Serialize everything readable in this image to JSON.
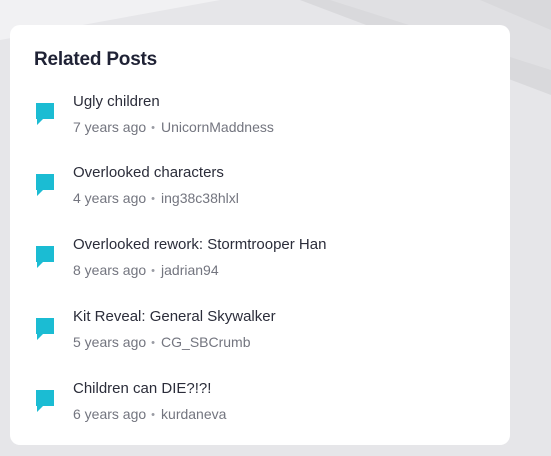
{
  "heading": "Related Posts",
  "colors": {
    "accent": "#1bbcd3",
    "card": "#ffffff",
    "background": "#e4e4e7"
  },
  "icon": "speech-bubble-icon",
  "meta_separator": "•",
  "posts": [
    {
      "title": "Ugly children",
      "age": "7 years ago",
      "author": "UnicornMaddness"
    },
    {
      "title": "Overlooked characters",
      "age": "4 years ago",
      "author": "ing38c38hlxl"
    },
    {
      "title": "Overlooked rework: Stormtrooper Han",
      "age": "8 years ago",
      "author": "jadrian94"
    },
    {
      "title": "Kit Reveal: General Skywalker",
      "age": "5 years ago",
      "author": "CG_SBCrumb"
    },
    {
      "title": "Children can DIE?!?!",
      "age": "6 years ago",
      "author": "kurdaneva"
    }
  ]
}
